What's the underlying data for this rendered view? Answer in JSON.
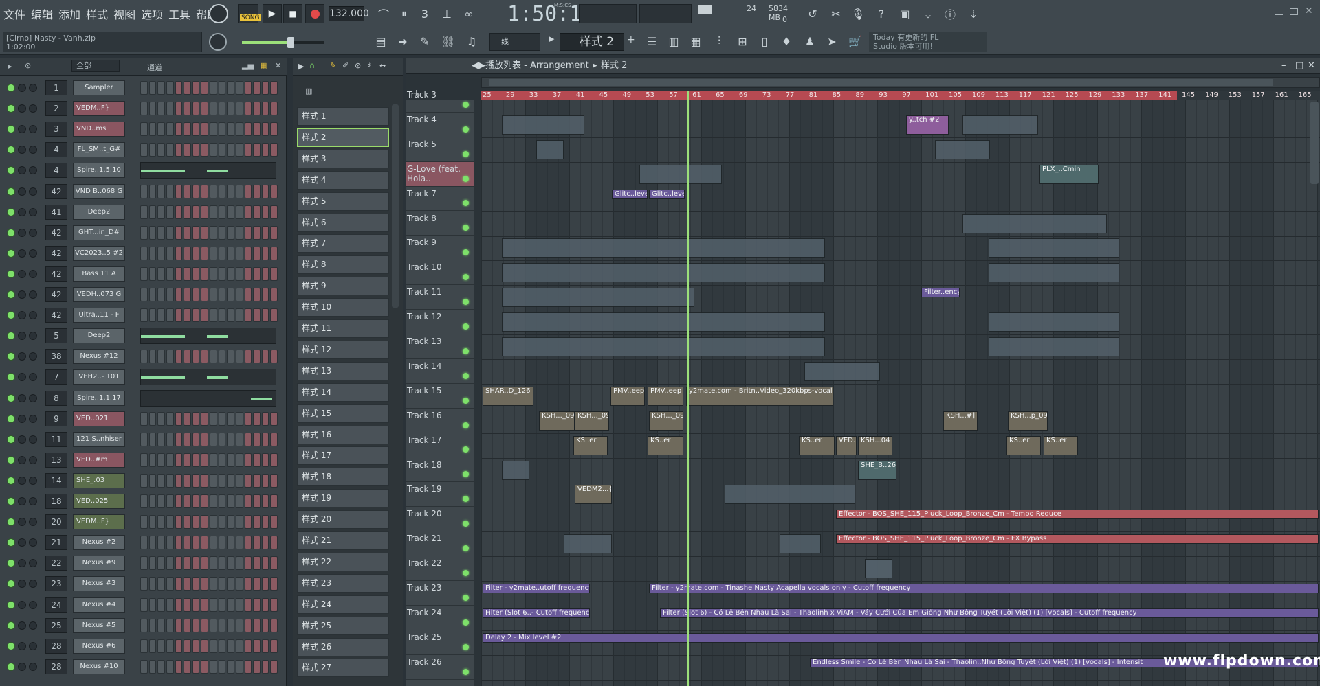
{
  "menu": [
    "文件",
    "编辑",
    "添加",
    "样式",
    "视图",
    "选项",
    "工具",
    "帮助"
  ],
  "transport": {
    "mode_label": "SONG",
    "tempo": "132.000",
    "time": "1:50:12",
    "time_unit": "M:S:CS"
  },
  "song": {
    "file_label": "[Cirno] Nasty - Vanh.zip",
    "position": "1:02:00"
  },
  "meter": {
    "cpu": "24",
    "memory": "5834 MB",
    "polyphony": "0"
  },
  "toolbar": {
    "snap": "线",
    "pattern": "样式 2"
  },
  "news": {
    "line1": "Today  有更新的 FL",
    "line2": "Studio 版本可用!"
  },
  "rack": {
    "filter": "全部",
    "channel_header": "通道",
    "channels": [
      {
        "num": "1",
        "name": "Sampler",
        "style": "gray",
        "mode": "steps"
      },
      {
        "num": "2",
        "name": "VEDM..F}",
        "style": "red",
        "mode": "steps"
      },
      {
        "num": "3",
        "name": "VND..ms",
        "style": "red",
        "mode": "steps"
      },
      {
        "num": "4",
        "name": "FL_SM..t_G#",
        "style": "gray",
        "mode": "steps"
      },
      {
        "num": "4",
        "name": "Spire..1.5.10",
        "style": "gray",
        "mode": "graph"
      },
      {
        "num": "42",
        "name": "VND B..068 G",
        "style": "gray",
        "mode": "steps"
      },
      {
        "num": "41",
        "name": "Deep2",
        "style": "gray",
        "mode": "steps"
      },
      {
        "num": "42",
        "name": "GHT...in_D#",
        "style": "gray",
        "mode": "steps"
      },
      {
        "num": "42",
        "name": "VC2023..5 #2",
        "style": "gray",
        "mode": "steps"
      },
      {
        "num": "42",
        "name": "Bass 11 A",
        "style": "gray",
        "mode": "steps"
      },
      {
        "num": "42",
        "name": "VEDH..073 G",
        "style": "gray",
        "mode": "steps"
      },
      {
        "num": "42",
        "name": "Ultra..11 - F",
        "style": "gray",
        "mode": "steps"
      },
      {
        "num": "5",
        "name": "Deep2",
        "style": "gray",
        "mode": "graph"
      },
      {
        "num": "38",
        "name": "Nexus #12",
        "style": "gray",
        "mode": "steps"
      },
      {
        "num": "7",
        "name": "VEH2..- 101",
        "style": "gray",
        "mode": "graph"
      },
      {
        "num": "8",
        "name": "Spire..1.1.17",
        "style": "gray",
        "mode": "graph2"
      },
      {
        "num": "9",
        "name": "VED..021",
        "style": "red",
        "mode": "steps"
      },
      {
        "num": "11",
        "name": "121 S..nhiser",
        "style": "gray",
        "mode": "steps"
      },
      {
        "num": "13",
        "name": "VED..#m",
        "style": "red",
        "mode": "steps"
      },
      {
        "num": "14",
        "name": "SHE_.03",
        "style": "green",
        "mode": "steps"
      },
      {
        "num": "18",
        "name": "VED..025",
        "style": "green",
        "mode": "steps"
      },
      {
        "num": "20",
        "name": "VEDM..F}",
        "style": "green",
        "mode": "steps"
      },
      {
        "num": "21",
        "name": "Nexus #2",
        "style": "gray",
        "mode": "steps"
      },
      {
        "num": "22",
        "name": "Nexus #9",
        "style": "gray",
        "mode": "steps"
      },
      {
        "num": "23",
        "name": "Nexus #3",
        "style": "gray",
        "mode": "steps"
      },
      {
        "num": "24",
        "name": "Nexus #4",
        "style": "gray",
        "mode": "steps"
      },
      {
        "num": "25",
        "name": "Nexus #5",
        "style": "gray",
        "mode": "steps"
      },
      {
        "num": "28",
        "name": "Nexus #6",
        "style": "gray",
        "mode": "steps"
      },
      {
        "num": "28",
        "name": "Nexus #10",
        "style": "gray",
        "mode": "steps"
      }
    ]
  },
  "patterns": [
    "样式 1",
    "样式 2",
    "样式 3",
    "样式 4",
    "样式 5",
    "样式 6",
    "样式 7",
    "样式 8",
    "样式 9",
    "样式 10",
    "样式 11",
    "样式 12",
    "样式 13",
    "样式 14",
    "样式 15",
    "样式 16",
    "样式 17",
    "样式 18",
    "样式 19",
    "样式 20",
    "样式 21",
    "样式 22",
    "样式 23",
    "样式 24",
    "样式 25",
    "样式 26",
    "样式 27"
  ],
  "playlist": {
    "title": "播放列表 - Arrangement",
    "current_pattern": "样式 2",
    "bars": [
      "25",
      "29",
      "33",
      "37",
      "41",
      "45",
      "49",
      "53",
      "57",
      "61",
      "65",
      "69",
      "73",
      "77",
      "81",
      "85",
      "89",
      "93",
      "97",
      "101",
      "105",
      "109",
      "113",
      "117",
      "121",
      "125",
      "129",
      "133",
      "137",
      "141",
      "145",
      "149",
      "153",
      "157",
      "161",
      "165"
    ],
    "tracks": [
      "Track 3",
      "Track 4",
      "Track 5",
      "G-Love (feat. Hola..",
      "Track 7",
      "Track 8",
      "Track 9",
      "Track 10",
      "Track 11",
      "Track 12",
      "Track 13",
      "Track 14",
      "Track 15",
      "Track 16",
      "Track 17",
      "Track 18",
      "Track 19",
      "Track 20",
      "Track 21",
      "Track 22",
      "Track 23",
      "Track 24",
      "Track 25",
      "Track 26"
    ],
    "clips": {
      "t4a": "y..tch #2",
      "t6a": "PLX_..Cmin",
      "t7a": "Glitc..level",
      "t7b": "Glitc..level",
      "t11a": "Filter..ency",
      "t15a": "SHAR..D_126",
      "t15b": "PMV..eep",
      "t15c": "PMV..eep",
      "t15d": "y2mate.com - Britn..Video_320kbps-vocals",
      "t16a": "KSH..._09",
      "t16b": "KSH..._09",
      "t16c": "KSH..._09",
      "t16d": "KSH...#]",
      "t16e": "KSH...p_09",
      "t17a": "KS..er",
      "t17b": "KS..er",
      "t17c": "KS..er",
      "t17d": "VED...",
      "t17e": "KSH...04",
      "t17f": "KS..er",
      "t17g": "KS..er",
      "t18a": "SHE_B..26_03",
      "t19a": "VEDM2...{F}",
      "t20a": "Effector - BOS_SHE_115_Pluck_Loop_Bronze_Cm - Tempo Reduce",
      "t21a": "Effector - BOS_SHE_115_Pluck_Loop_Bronze_Cm - FX Bypass",
      "t23a": "Filter - y2mate..utoff frequency",
      "t23b": "Filter - y2mate.com - Tinashe  Nasty Acapella  vocals only - Cutoff frequency",
      "t24a": "Filter (Slot 6..- Cutoff frequency",
      "t24b": "Filter (Slot 6) - Có Lẽ Bên Nhau Là Sai - Thaolinh x ViAM - Váy Cưới Của Em Giống Như Bông Tuyết (Lời Việt) (1) [vocals] - Cutoff frequency",
      "t25a": "Delay 2 - Mix level #2",
      "t26a": "Endless Smile - Có Lẽ Bên Nhau Là Sai - Thaolin..Như Bông Tuyết (Lời Việt) (1) [vocals] - Intensit"
    }
  },
  "watermark": "www.flpdown.com",
  "colors": {
    "accent_green": "#9ce07a",
    "timeline_red": "#b64a52",
    "automation_purple": "#6a5a9a"
  }
}
